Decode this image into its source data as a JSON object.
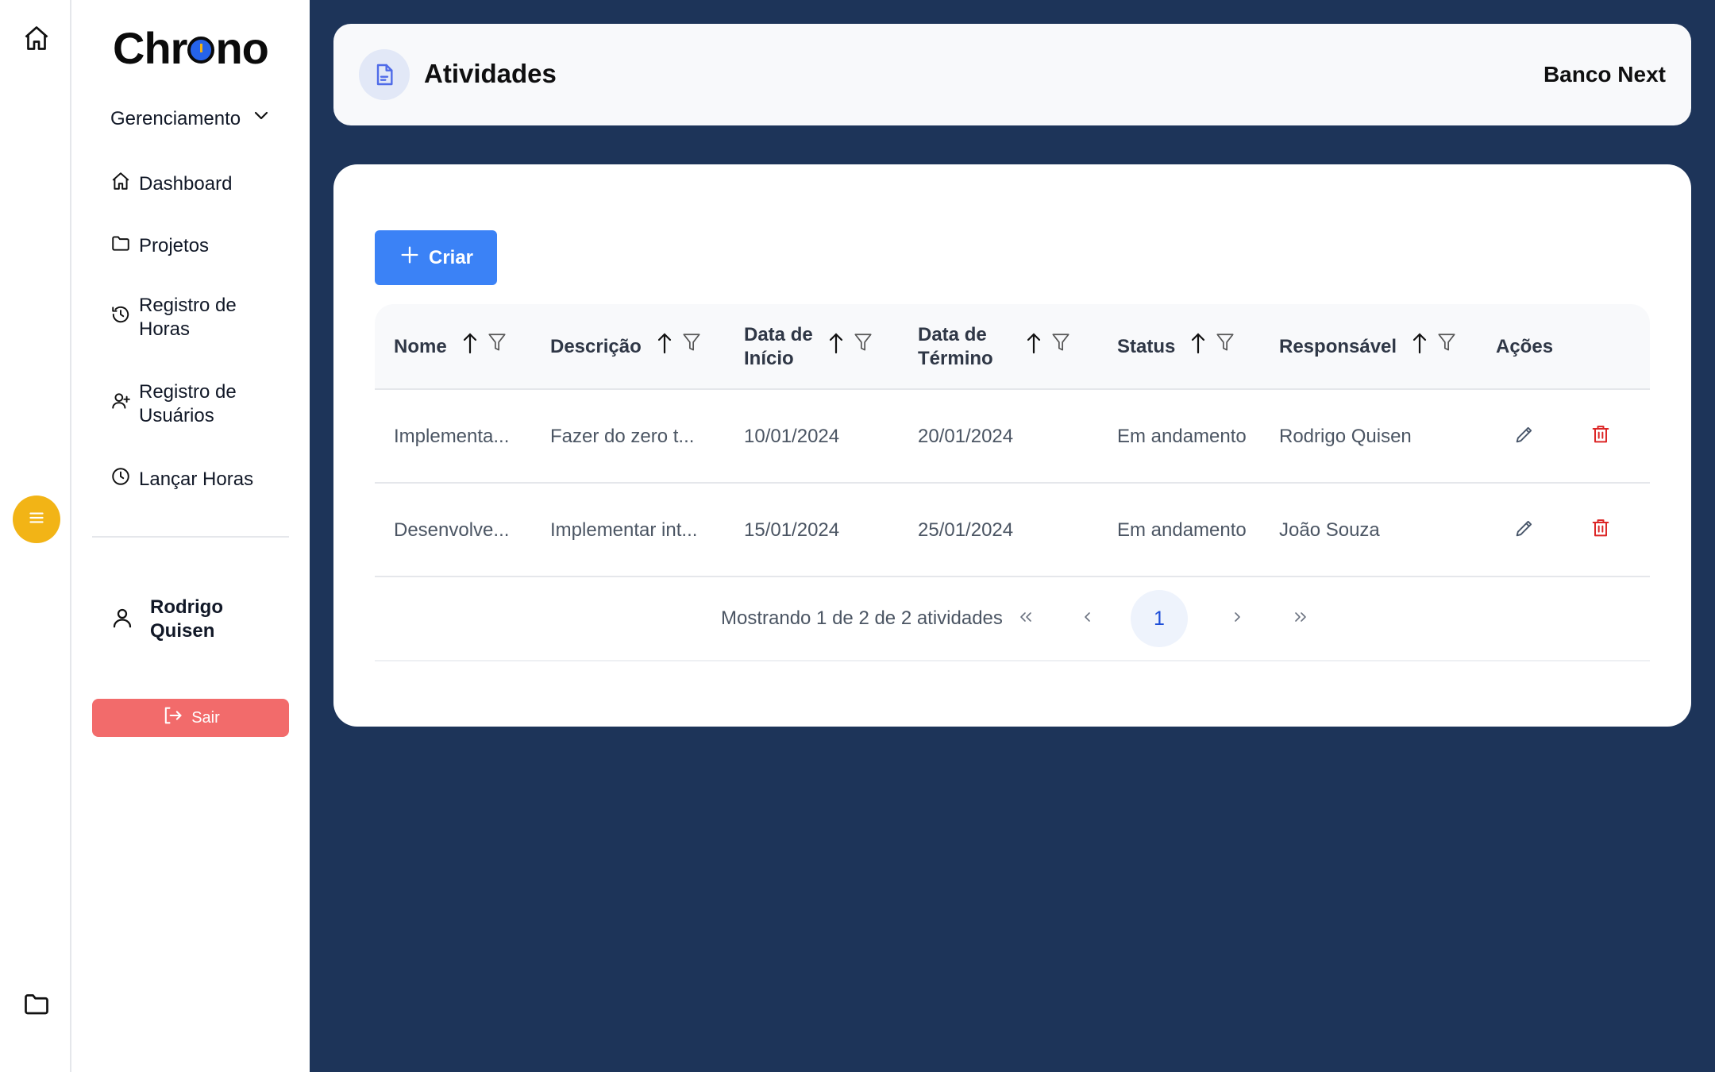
{
  "app": {
    "logo_text": "Chrono",
    "logo_left": "Chr",
    "logo_right": "no"
  },
  "rail": {
    "home_icon": "home-icon",
    "menu_icon": "hamburger-icon",
    "menu_color": "#f2b416",
    "folder_icon": "folder-icon"
  },
  "sidebar": {
    "section_label": "Gerenciamento",
    "items": [
      {
        "icon": "home-icon",
        "label": "Dashboard"
      },
      {
        "icon": "folder-icon",
        "label": "Projetos"
      },
      {
        "icon": "history-icon",
        "label_line1": "Registro de",
        "label_line2": "Horas"
      },
      {
        "icon": "user-plus-icon",
        "label_line1": "Registro de",
        "label_line2": "Usuários"
      },
      {
        "icon": "clock-icon",
        "label": "Lançar Horas"
      }
    ],
    "user": {
      "first_name": "Rodrigo",
      "last_name": "Quisen"
    },
    "logout_label": "Sair",
    "logout_color": "#f26b6b"
  },
  "header": {
    "title": "Atividades",
    "organization": "Banco Next",
    "icon": "document-icon"
  },
  "main": {
    "create_label": "Criar",
    "create_color": "#3b82f6",
    "columns": [
      {
        "line1": "Nome"
      },
      {
        "line1": "Descrição"
      },
      {
        "line1": "Data de",
        "line2": "Início"
      },
      {
        "line1": "Data de",
        "line2": "Término"
      },
      {
        "line1": "Status"
      },
      {
        "line1": "Responsável"
      },
      {
        "line1": "Ações"
      }
    ],
    "rows": [
      {
        "nome": "Implementa...",
        "descricao": "Fazer do zero t...",
        "inicio": "10/01/2024",
        "termino": "20/01/2024",
        "status": "Em andamento",
        "responsavel": "Rodrigo Quisen"
      },
      {
        "nome": "Desenvolve...",
        "descricao": "Implementar int...",
        "inicio": "15/01/2024",
        "termino": "25/01/2024",
        "status": "Em andamento",
        "responsavel": "João Souza"
      }
    ],
    "pagination": {
      "info": "Mostrando 1 de 2 de 2 atividades",
      "current_page": "1"
    }
  },
  "colors": {
    "background": "#1d3459",
    "delete": "#dc2626",
    "edit": "#475569"
  }
}
